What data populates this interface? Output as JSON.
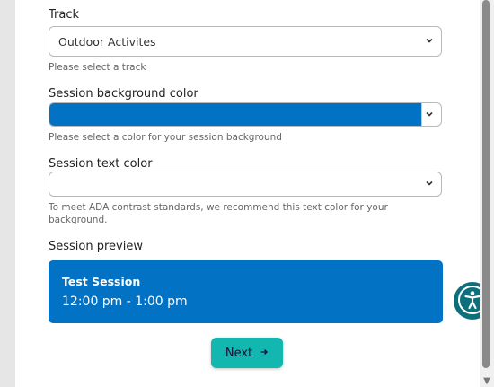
{
  "track": {
    "label": "Track",
    "value": "Outdoor Activites",
    "hint": "Please select a track"
  },
  "background_color": {
    "label": "Session background color",
    "value": "#0272C4",
    "hint": "Please select a color for your session background"
  },
  "text_color": {
    "label": "Session text color",
    "value": "",
    "hint": "To meet ADA contrast standards, we recommend this text color for your background."
  },
  "preview": {
    "label": "Session preview",
    "title": "Test Session",
    "time": "12:00 pm - 1:00 pm"
  },
  "next_button": {
    "label": "Next",
    "icon": "arrow-right-icon"
  },
  "accessibility_button": {
    "icon": "accessibility-icon"
  },
  "colors": {
    "session_bg": "#0272C4",
    "preview_text": "#FFFFFF",
    "next_button": "#12B8B0",
    "accessibility_button": "#0E6F7C"
  }
}
